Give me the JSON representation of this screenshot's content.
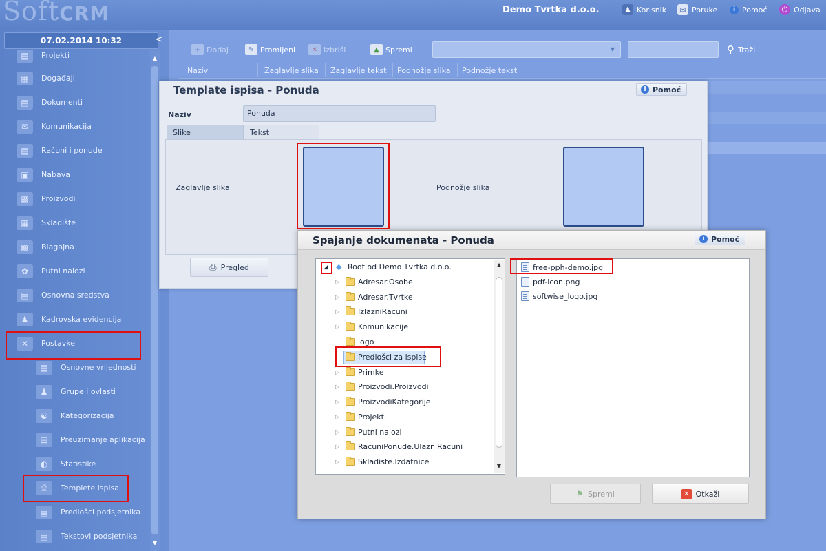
{
  "header": {
    "logo_text": "Soft",
    "logo_crm": "CRM",
    "company": "Demo Tvrtka d.o.o.",
    "nav": [
      {
        "label": "Korisnik",
        "icon": "user-icon"
      },
      {
        "label": "Poruke",
        "icon": "messages-icon"
      },
      {
        "label": "Pomoć",
        "icon": "help-icon"
      },
      {
        "label": "Odjava",
        "icon": "power-icon"
      }
    ]
  },
  "sidebar": {
    "datetime": "07.02.2014 10:32",
    "collapse_label": "<",
    "items": [
      {
        "label": "Projekti",
        "icon": "projects-icon"
      },
      {
        "label": "Događaji",
        "icon": "events-icon"
      },
      {
        "label": "Dokumenti",
        "icon": "documents-icon"
      },
      {
        "label": "Komunikacija",
        "icon": "communication-icon"
      },
      {
        "label": "Računi i ponude",
        "icon": "invoices-icon"
      },
      {
        "label": "Nabava",
        "icon": "procurement-icon"
      },
      {
        "label": "Proizvodi",
        "icon": "products-icon"
      },
      {
        "label": "Skladište",
        "icon": "warehouse-icon"
      },
      {
        "label": "Blagajna",
        "icon": "cashbox-icon"
      },
      {
        "label": "Putni nalozi",
        "icon": "travel-orders-icon"
      },
      {
        "label": "Osnovna sredstva",
        "icon": "assets-icon"
      },
      {
        "label": "Kadrovska evidencija",
        "icon": "hr-icon"
      },
      {
        "label": "Postavke",
        "icon": "settings-icon"
      }
    ],
    "subitems": [
      {
        "label": "Osnovne vrijednosti",
        "icon": "basic-values-icon"
      },
      {
        "label": "Grupe i ovlasti",
        "icon": "groups-icon"
      },
      {
        "label": "Kategorizacija",
        "icon": "categorization-icon"
      },
      {
        "label": "Preuzimanje aplikacija",
        "icon": "download-apps-icon"
      },
      {
        "label": "Statistike",
        "icon": "statistics-icon"
      },
      {
        "label": "Templete ispisa",
        "icon": "print-template-icon"
      },
      {
        "label": "Predlošci podsjetnika",
        "icon": "reminder-templates-icon"
      },
      {
        "label": "Tekstovi podsjetnika",
        "icon": "reminder-texts-icon"
      }
    ]
  },
  "toolbar": {
    "add_label": "Dodaj",
    "edit_label": "Promijeni",
    "delete_label": "Izbriši",
    "save_label": "Spremi",
    "search_label": "Traži",
    "search_value": "",
    "filter_value": ""
  },
  "grid": {
    "columns": [
      "Naziv",
      "Zaglavlje slika",
      "Zaglavlje tekst",
      "Podnožje slika",
      "Podnožje tekst"
    ]
  },
  "template_dialog": {
    "title": "Template ispisa - Ponuda",
    "help_label": "Pomoć",
    "naziv_label": "Naziv",
    "naziv_value": "Ponuda",
    "tabs": [
      "Slike",
      "Tekst"
    ],
    "header_image_label": "Zaglavlje slika",
    "footer_image_label": "Podnožje slika",
    "preview_label": "Pregled"
  },
  "merge_dialog": {
    "title": "Spajanje dokumenata - Ponuda",
    "help_label": "Pomoć",
    "tree_root": "Root od Demo Tvrtka d.o.o.",
    "folders": [
      {
        "label": "Adresar.Osobe",
        "expandable": true
      },
      {
        "label": "Adresar.Tvrtke",
        "expandable": true
      },
      {
        "label": "IzlazniRacuni",
        "expandable": true
      },
      {
        "label": "Komunikacije",
        "expandable": true
      },
      {
        "label": "logo",
        "expandable": false
      },
      {
        "label": "Predlošci za ispise",
        "expandable": false,
        "selected": true
      },
      {
        "label": "Primke",
        "expandable": true
      },
      {
        "label": "Proizvodi.Proizvodi",
        "expandable": true
      },
      {
        "label": "ProizvodiKategorije",
        "expandable": true
      },
      {
        "label": "Projekti",
        "expandable": true
      },
      {
        "label": "Putni nalozi",
        "expandable": true
      },
      {
        "label": "RacuniPonude.UlazniRacuni",
        "expandable": true
      },
      {
        "label": "Skladiste.Izdatnice",
        "expandable": true
      }
    ],
    "files": [
      "free-pph-demo.jpg",
      "pdf-icon.png",
      "softwise_logo.jpg"
    ],
    "save_label": "Spremi",
    "cancel_label": "Otkaži"
  },
  "colors": {
    "highlight": "#e01010",
    "accent": "#3c78d8",
    "sidebar": "#5b82c9"
  }
}
